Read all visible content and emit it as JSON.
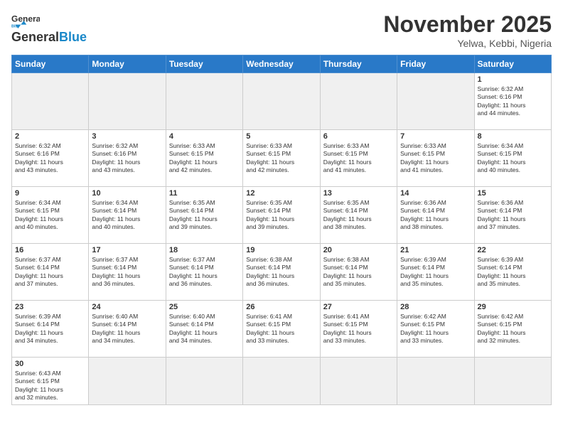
{
  "header": {
    "logo_general": "General",
    "logo_blue": "Blue",
    "month_title": "November 2025",
    "location": "Yelwa, Kebbi, Nigeria"
  },
  "weekdays": [
    "Sunday",
    "Monday",
    "Tuesday",
    "Wednesday",
    "Thursday",
    "Friday",
    "Saturday"
  ],
  "weeks": [
    [
      {
        "day": "",
        "info": ""
      },
      {
        "day": "",
        "info": ""
      },
      {
        "day": "",
        "info": ""
      },
      {
        "day": "",
        "info": ""
      },
      {
        "day": "",
        "info": ""
      },
      {
        "day": "",
        "info": ""
      },
      {
        "day": "1",
        "info": "Sunrise: 6:32 AM\nSunset: 6:16 PM\nDaylight: 11 hours\nand 44 minutes."
      }
    ],
    [
      {
        "day": "2",
        "info": "Sunrise: 6:32 AM\nSunset: 6:16 PM\nDaylight: 11 hours\nand 43 minutes."
      },
      {
        "day": "3",
        "info": "Sunrise: 6:32 AM\nSunset: 6:16 PM\nDaylight: 11 hours\nand 43 minutes."
      },
      {
        "day": "4",
        "info": "Sunrise: 6:33 AM\nSunset: 6:15 PM\nDaylight: 11 hours\nand 42 minutes."
      },
      {
        "day": "5",
        "info": "Sunrise: 6:33 AM\nSunset: 6:15 PM\nDaylight: 11 hours\nand 42 minutes."
      },
      {
        "day": "6",
        "info": "Sunrise: 6:33 AM\nSunset: 6:15 PM\nDaylight: 11 hours\nand 41 minutes."
      },
      {
        "day": "7",
        "info": "Sunrise: 6:33 AM\nSunset: 6:15 PM\nDaylight: 11 hours\nand 41 minutes."
      },
      {
        "day": "8",
        "info": "Sunrise: 6:34 AM\nSunset: 6:15 PM\nDaylight: 11 hours\nand 40 minutes."
      }
    ],
    [
      {
        "day": "9",
        "info": "Sunrise: 6:34 AM\nSunset: 6:15 PM\nDaylight: 11 hours\nand 40 minutes."
      },
      {
        "day": "10",
        "info": "Sunrise: 6:34 AM\nSunset: 6:14 PM\nDaylight: 11 hours\nand 40 minutes."
      },
      {
        "day": "11",
        "info": "Sunrise: 6:35 AM\nSunset: 6:14 PM\nDaylight: 11 hours\nand 39 minutes."
      },
      {
        "day": "12",
        "info": "Sunrise: 6:35 AM\nSunset: 6:14 PM\nDaylight: 11 hours\nand 39 minutes."
      },
      {
        "day": "13",
        "info": "Sunrise: 6:35 AM\nSunset: 6:14 PM\nDaylight: 11 hours\nand 38 minutes."
      },
      {
        "day": "14",
        "info": "Sunrise: 6:36 AM\nSunset: 6:14 PM\nDaylight: 11 hours\nand 38 minutes."
      },
      {
        "day": "15",
        "info": "Sunrise: 6:36 AM\nSunset: 6:14 PM\nDaylight: 11 hours\nand 37 minutes."
      }
    ],
    [
      {
        "day": "16",
        "info": "Sunrise: 6:37 AM\nSunset: 6:14 PM\nDaylight: 11 hours\nand 37 minutes."
      },
      {
        "day": "17",
        "info": "Sunrise: 6:37 AM\nSunset: 6:14 PM\nDaylight: 11 hours\nand 36 minutes."
      },
      {
        "day": "18",
        "info": "Sunrise: 6:37 AM\nSunset: 6:14 PM\nDaylight: 11 hours\nand 36 minutes."
      },
      {
        "day": "19",
        "info": "Sunrise: 6:38 AM\nSunset: 6:14 PM\nDaylight: 11 hours\nand 36 minutes."
      },
      {
        "day": "20",
        "info": "Sunrise: 6:38 AM\nSunset: 6:14 PM\nDaylight: 11 hours\nand 35 minutes."
      },
      {
        "day": "21",
        "info": "Sunrise: 6:39 AM\nSunset: 6:14 PM\nDaylight: 11 hours\nand 35 minutes."
      },
      {
        "day": "22",
        "info": "Sunrise: 6:39 AM\nSunset: 6:14 PM\nDaylight: 11 hours\nand 35 minutes."
      }
    ],
    [
      {
        "day": "23",
        "info": "Sunrise: 6:39 AM\nSunset: 6:14 PM\nDaylight: 11 hours\nand 34 minutes."
      },
      {
        "day": "24",
        "info": "Sunrise: 6:40 AM\nSunset: 6:14 PM\nDaylight: 11 hours\nand 34 minutes."
      },
      {
        "day": "25",
        "info": "Sunrise: 6:40 AM\nSunset: 6:14 PM\nDaylight: 11 hours\nand 34 minutes."
      },
      {
        "day": "26",
        "info": "Sunrise: 6:41 AM\nSunset: 6:15 PM\nDaylight: 11 hours\nand 33 minutes."
      },
      {
        "day": "27",
        "info": "Sunrise: 6:41 AM\nSunset: 6:15 PM\nDaylight: 11 hours\nand 33 minutes."
      },
      {
        "day": "28",
        "info": "Sunrise: 6:42 AM\nSunset: 6:15 PM\nDaylight: 11 hours\nand 33 minutes."
      },
      {
        "day": "29",
        "info": "Sunrise: 6:42 AM\nSunset: 6:15 PM\nDaylight: 11 hours\nand 32 minutes."
      }
    ],
    [
      {
        "day": "30",
        "info": "Sunrise: 6:43 AM\nSunset: 6:15 PM\nDaylight: 11 hours\nand 32 minutes."
      },
      {
        "day": "",
        "info": ""
      },
      {
        "day": "",
        "info": ""
      },
      {
        "day": "",
        "info": ""
      },
      {
        "day": "",
        "info": ""
      },
      {
        "day": "",
        "info": ""
      },
      {
        "day": "",
        "info": ""
      }
    ]
  ]
}
